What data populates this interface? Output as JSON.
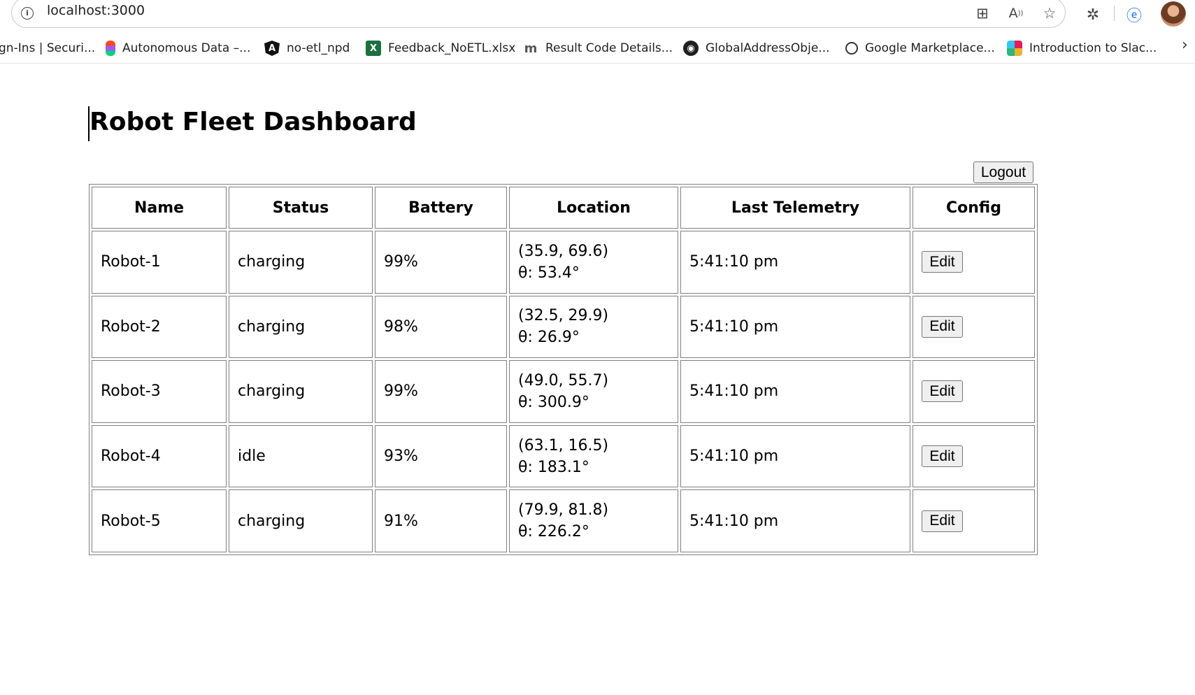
{
  "browser": {
    "url": "localhost:3000",
    "bookmarks": [
      {
        "label": "gn-Ins | Securi...",
        "icon": "none"
      },
      {
        "label": "Autonomous Data –...",
        "icon": "figma-icon"
      },
      {
        "label": "no-etl_npd",
        "icon": "angular-icon"
      },
      {
        "label": "Feedback_NoETL.xlsx",
        "icon": "excel-icon"
      },
      {
        "label": "Result Code Details...",
        "icon": "m-icon"
      },
      {
        "label": "GlobalAddressObje...",
        "icon": "github-icon"
      },
      {
        "label": "Google Marketplace...",
        "icon": "globe-icon"
      },
      {
        "label": "Introduction to Slac...",
        "icon": "slack-icon"
      }
    ]
  },
  "page": {
    "title": "Robot Fleet Dashboard",
    "logout_label": "Logout"
  },
  "table": {
    "columns": [
      "Name",
      "Status",
      "Battery",
      "Location",
      "Last Telemetry",
      "Config"
    ],
    "rows": [
      {
        "name": "Robot-1",
        "status": "charging",
        "battery": "99%",
        "location_xy": "(35.9, 69.6)",
        "location_theta": "θ: 53.4°",
        "last_telemetry": "5:41:10 pm",
        "config_label": "Edit"
      },
      {
        "name": "Robot-2",
        "status": "charging",
        "battery": "98%",
        "location_xy": "(32.5, 29.9)",
        "location_theta": "θ: 26.9°",
        "last_telemetry": "5:41:10 pm",
        "config_label": "Edit"
      },
      {
        "name": "Robot-3",
        "status": "charging",
        "battery": "99%",
        "location_xy": "(49.0, 55.7)",
        "location_theta": "θ: 300.9°",
        "last_telemetry": "5:41:10 pm",
        "config_label": "Edit"
      },
      {
        "name": "Robot-4",
        "status": "idle",
        "battery": "93%",
        "location_xy": "(63.1, 16.5)",
        "location_theta": "θ: 183.1°",
        "last_telemetry": "5:41:10 pm",
        "config_label": "Edit"
      },
      {
        "name": "Robot-5",
        "status": "charging",
        "battery": "91%",
        "location_xy": "(79.9, 81.8)",
        "location_theta": "θ: 226.2°",
        "last_telemetry": "5:41:10 pm",
        "config_label": "Edit"
      }
    ]
  }
}
